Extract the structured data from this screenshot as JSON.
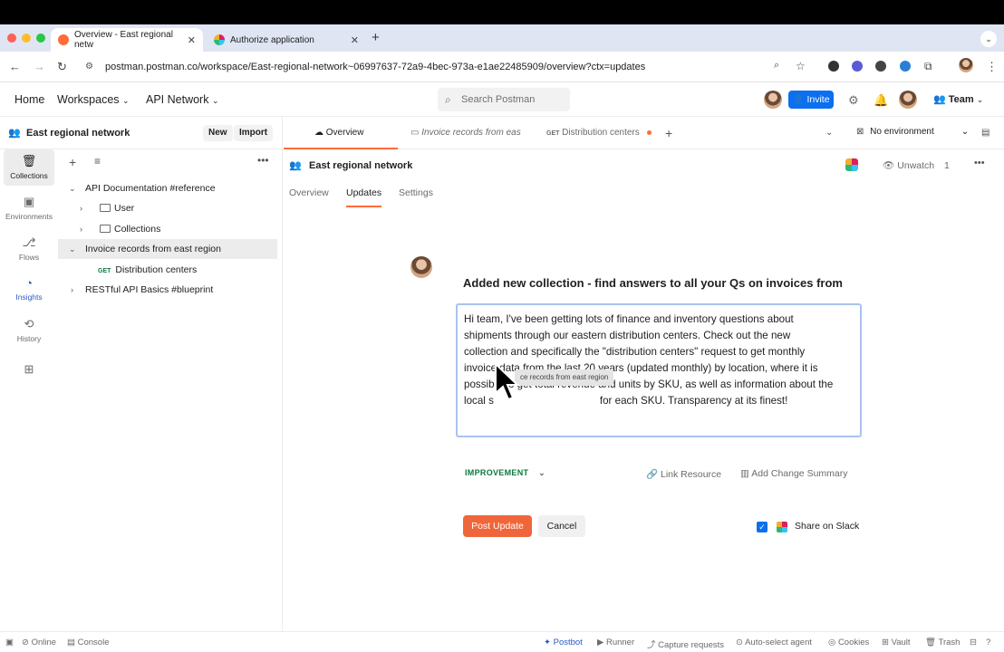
{
  "browser": {
    "tabs": [
      {
        "title": "Overview - East regional netw",
        "active": true
      },
      {
        "title": "Authorize application",
        "active": false
      }
    ],
    "url": "postman.postman.co/workspace/East-regional-network~06997637-72a9-4bec-973a-e1ae22485909/overview?ctx=updates"
  },
  "appbar": {
    "home": "Home",
    "workspaces": "Workspaces",
    "api_network": "API Network",
    "search_placeholder": "Search Postman",
    "invite": "Invite",
    "team": "Team"
  },
  "sidebar": {
    "workspace_title": "East regional network",
    "new_label": "New",
    "import_label": "Import",
    "rail": [
      {
        "label": "Collections",
        "icon": "collections-icon"
      },
      {
        "label": "Environments",
        "icon": "environments-icon"
      },
      {
        "label": "Flows",
        "icon": "flows-icon"
      },
      {
        "label": "Insights",
        "icon": "insights-icon"
      },
      {
        "label": "History",
        "icon": "history-icon"
      }
    ],
    "tree": [
      {
        "label": "API Documentation #reference"
      },
      {
        "label": "User"
      },
      {
        "label": "Collections"
      },
      {
        "label": "Invoice records from east region"
      },
      {
        "method": "GET",
        "label": "Distribution centers"
      },
      {
        "label": "RESTful API Basics #blueprint"
      }
    ]
  },
  "main": {
    "tabs": [
      {
        "label": "Overview"
      },
      {
        "label": "Invoice records from eas"
      },
      {
        "method": "GET",
        "label": "Distribution centers"
      }
    ],
    "environment": "No environment",
    "workspace_title": "East regional network",
    "unwatch": "Unwatch",
    "watch_count": "1",
    "subtabs": [
      "Overview",
      "Updates",
      "Settings"
    ],
    "update": {
      "title": "Added new collection - find answers to all your Qs on invoices from",
      "body_lines": [
        "Hi team, I've been getting lots of finance and inventory questions about",
        "shipments through our eastern distribution centers. Check out the new",
        "collection and specifically the \"distribution centers\" request to get monthly",
        "invoice data from the last 20 years (updated monthly) by location, where it is",
        "possible to get total revenue and units by SKU, as well as information about the",
        "local s",
        "for each SKU. Transparency at its finest!"
      ],
      "drag_tooltip": "ce records from east region",
      "tag": "IMPROVEMENT",
      "link_resource": "Link Resource",
      "add_change_summary": "Add Change Summary",
      "post_button": "Post Update",
      "cancel_button": "Cancel",
      "share_on_slack": "Share on Slack",
      "share_checked": true
    }
  },
  "statusbar": {
    "online": "Online",
    "console": "Console",
    "postbot": "Postbot",
    "runner": "Runner",
    "capture": "Capture requests",
    "agent": "Auto-select agent",
    "cookies": "Cookies",
    "vault": "Vault",
    "trash": "Trash"
  },
  "colors": {
    "accent": "#ff6c37",
    "primary": "#0a6ff0",
    "success": "#0c7a3f"
  }
}
